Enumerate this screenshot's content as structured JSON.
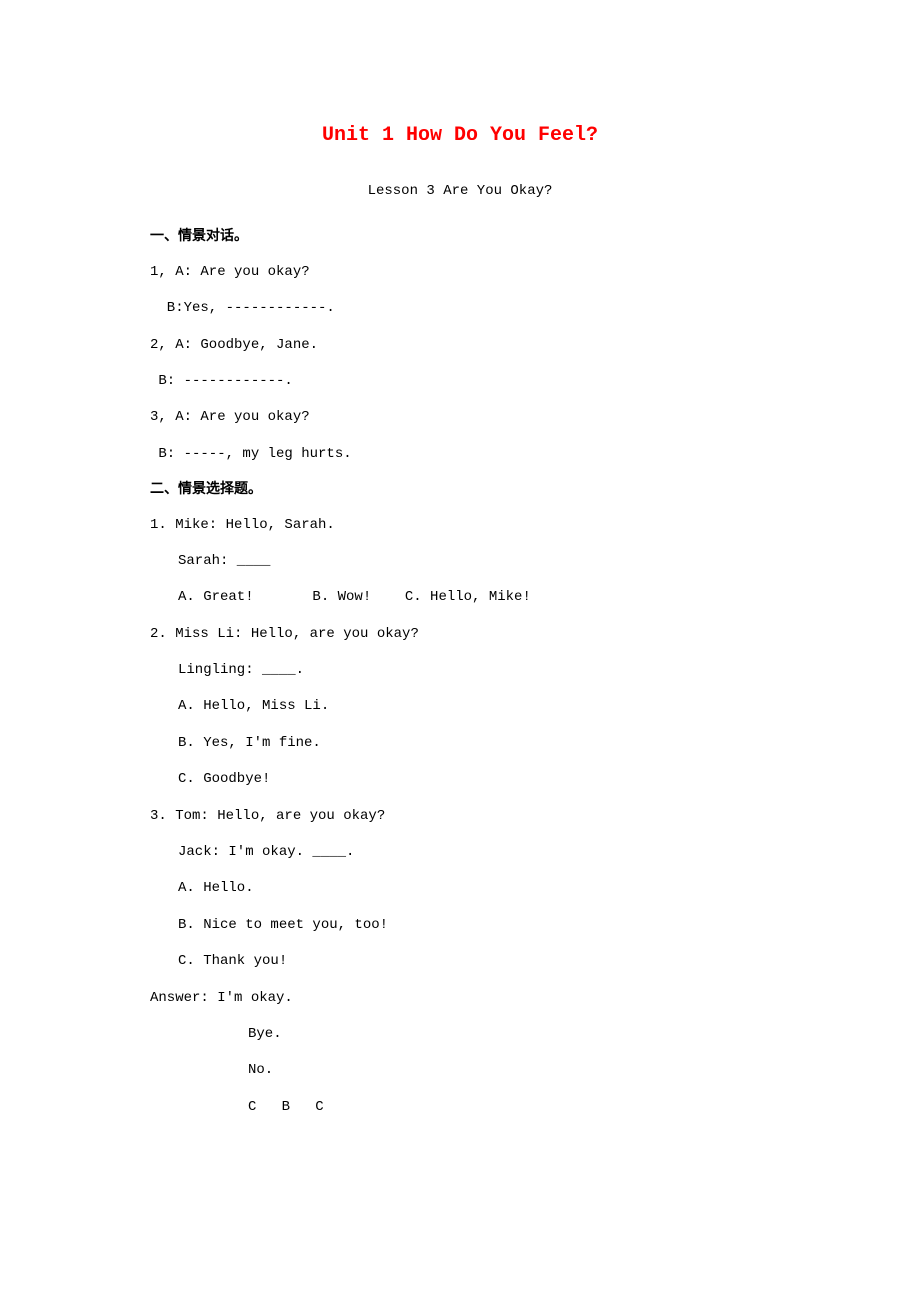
{
  "title": "Unit 1 How Do You Feel?",
  "subtitle": "Lesson 3 Are You Okay?",
  "section1": {
    "heading": "一、情景对话。",
    "q1a": "1, A: Are you okay?",
    "q1b": "  B:Yes, ------------.",
    "q2a": "2, A: Goodbye, Jane.",
    "q2b": " B: ------------.",
    "q3a": "3, A: Are you okay?",
    "q3b": " B: -----, my leg hurts."
  },
  "section2": {
    "heading": "二、情景选择题。",
    "q1a": "1. Mike: Hello, Sarah.",
    "q1b": "Sarah: ____",
    "q1c": "A. Great!       B. Wow!    C. Hello, Mike!",
    "q2a": "2. Miss Li: Hello, are you okay?",
    "q2b": "Lingling: ____.",
    "q2c": "A. Hello, Miss Li.",
    "q2d": "B. Yes, I'm fine.",
    "q2e": "C. Goodbye!",
    "q3a": "3. Tom: Hello, are you okay?",
    "q3b": "Jack: I'm okay. ____.",
    "q3c": "A. Hello.",
    "q3d": "B. Nice to meet you, too!",
    "q3e": "C. Thank you!"
  },
  "answers": {
    "label": "Answer: I'm okay.",
    "a1": "Bye.",
    "a2": "No.",
    "a3": "C   B   C"
  }
}
